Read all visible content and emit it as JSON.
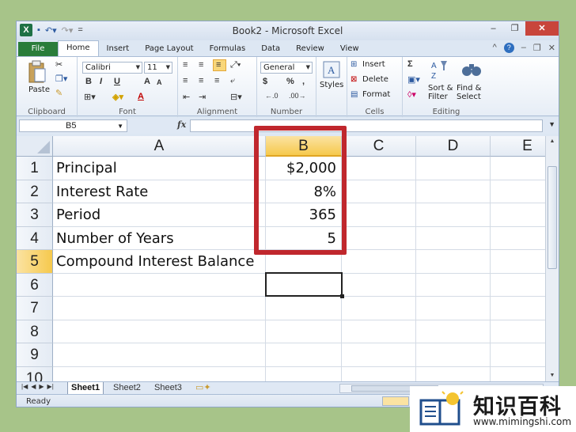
{
  "window": {
    "title": "Book2 - Microsoft Excel",
    "controls": {
      "minimize": "–",
      "restore": "❐",
      "close": "✕"
    }
  },
  "qat": {
    "save_icon": "save-icon",
    "undo_icon": "undo-icon",
    "redo_icon": "redo-icon"
  },
  "tabs": [
    "File",
    "Home",
    "Insert",
    "Page Layout",
    "Formulas",
    "Data",
    "Review",
    "View"
  ],
  "tab_right": {
    "caret": "^",
    "help": "?",
    "min": "–",
    "restore": "❐",
    "close": "✕"
  },
  "ribbon": {
    "clipboard": {
      "paste": "Paste",
      "label": "Clipboard"
    },
    "font": {
      "name": "Calibri",
      "size": "11",
      "bold": "B",
      "italic": "I",
      "underline": "U",
      "grow": "A",
      "shrink": "A",
      "font_color": "A",
      "label": "Font"
    },
    "alignment": {
      "label": "Alignment"
    },
    "number": {
      "format": "General",
      "currency": "$",
      "percent": "%",
      "comma": ",",
      "label": "Number"
    },
    "styles": {
      "label": "Styles"
    },
    "cells": {
      "insert": "Insert",
      "delete": "Delete",
      "format": "Format",
      "label": "Cells"
    },
    "editing": {
      "sigma": "Σ",
      "sort_line1": "Sort &",
      "sort_line2": "Filter",
      "find_line1": "Find &",
      "find_line2": "Select",
      "label": "Editing"
    }
  },
  "formula_bar": {
    "name_box": "B5",
    "fx": "fx",
    "value": ""
  },
  "columns": [
    "A",
    "B",
    "C",
    "D",
    "E"
  ],
  "selected_column": "B",
  "rows": [
    {
      "num": "1",
      "a": "Principal",
      "b": "$2,000"
    },
    {
      "num": "2",
      "a": "Interest Rate",
      "b": "8%"
    },
    {
      "num": "3",
      "a": "Period",
      "b": "365"
    },
    {
      "num": "4",
      "a": "Number of Years",
      "b": "5"
    },
    {
      "num": "5",
      "a": "Compound Interest Balance",
      "b": ""
    },
    {
      "num": "6",
      "a": "",
      "b": ""
    },
    {
      "num": "7",
      "a": "",
      "b": ""
    },
    {
      "num": "8",
      "a": "",
      "b": ""
    },
    {
      "num": "9",
      "a": "",
      "b": ""
    },
    {
      "num": "10",
      "a": "",
      "b": ""
    }
  ],
  "selected_row": "5",
  "sheet_tabs": [
    "Sheet1",
    "Sheet2",
    "Sheet3"
  ],
  "active_sheet": "Sheet1",
  "status": {
    "ready": "Ready"
  },
  "watermark": {
    "cn": "知识百科",
    "url": "www.mimingshi.com"
  },
  "colors": {
    "highlight": "#c0272d",
    "file_tab": "#2a7d3a",
    "selected_header": "#f6c94d",
    "background": "#a7c489"
  }
}
